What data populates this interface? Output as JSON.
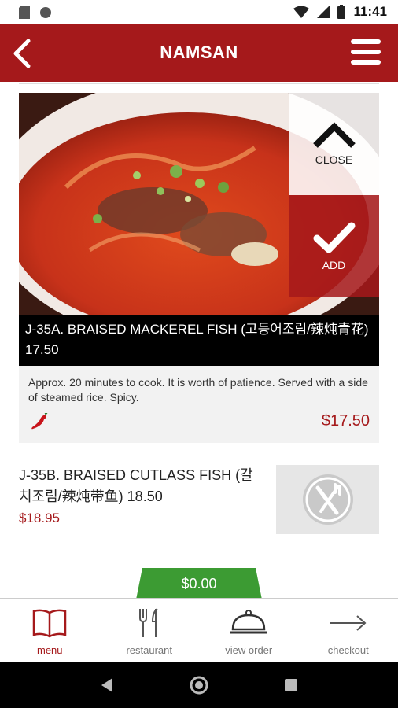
{
  "status_bar": {
    "time": "11:41"
  },
  "header": {
    "title": "NAMSAN"
  },
  "expanded_item": {
    "close_label": "CLOSE",
    "add_label": "ADD",
    "name": "J-35A. BRAISED MACKEREL FISH (고등어조림/辣炖青花) 17.50",
    "description": "Approx. 20 minutes to cook. It is worth of patience. Served with a side of steamed rice. Spicy.",
    "price": "$17.50",
    "spicy_icon": "chili-pepper"
  },
  "list_item": {
    "name": "J-35B. BRAISED CUTLASS FISH (갈치조림/辣炖带鱼) 18.50",
    "price": "$18.95",
    "thumb_icon": "fork-knife"
  },
  "cart": {
    "total": "$0.00"
  },
  "tabs": [
    {
      "label": "menu",
      "icon": "open-book",
      "active": true
    },
    {
      "label": "restaurant",
      "icon": "fork-knife"
    },
    {
      "label": "view order",
      "icon": "cloche"
    },
    {
      "label": "checkout",
      "icon": "arrow-right"
    }
  ],
  "colors": {
    "brand": "#a5191b",
    "cart": "#3c9b33"
  }
}
